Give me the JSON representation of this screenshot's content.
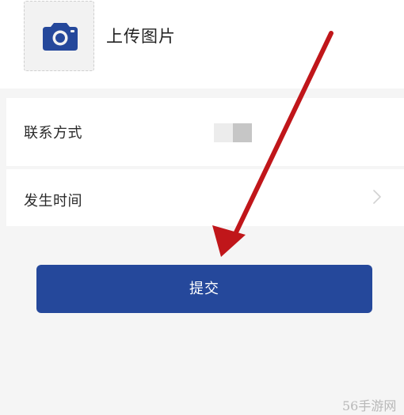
{
  "upload": {
    "label": "上传图片",
    "icon": "camera-icon"
  },
  "form": {
    "contact_label": "联系方式",
    "time_label": "发生时间",
    "time_chevron_icon": "chevron-right-icon"
  },
  "submit": {
    "label": "提交"
  },
  "watermark": {
    "text": "56手游网"
  },
  "colors": {
    "primary": "#25489b",
    "annotation_arrow": "#c0161a"
  }
}
